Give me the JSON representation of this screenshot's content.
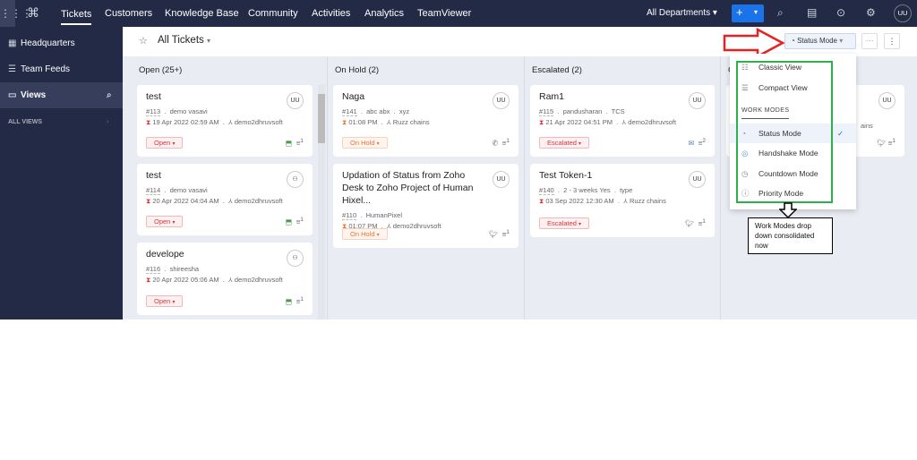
{
  "topbar": {
    "nav": [
      "Tickets",
      "Customers",
      "Knowledge Base",
      "Community",
      "Activities",
      "Analytics",
      "TeamViewer"
    ],
    "department": "All Departments",
    "user_initials": "UU",
    "icons": [
      "apps-grid-icon",
      "logo-icon",
      "plus-icon",
      "search-icon",
      "notifications-icon",
      "gamepad-icon",
      "gear-icon"
    ]
  },
  "sidebar": {
    "items": [
      {
        "label": "Headquarters",
        "icon": "grid-icon"
      },
      {
        "label": "Team Feeds",
        "icon": "feed-icon"
      },
      {
        "label": "Views",
        "icon": "folder-icon"
      }
    ],
    "all_views": "ALL VIEWS"
  },
  "header": {
    "view_title": "All Tickets",
    "mode_button": "Status Mode"
  },
  "columns": [
    {
      "title": "Open (25+)",
      "cards": [
        {
          "title": "test",
          "id": "#113",
          "contact": "demo vasavi",
          "extra": "",
          "time": "19 Apr 2022 02:59 AM",
          "account": "demo2dhruvsoft",
          "status": "Open",
          "avatar": "UU",
          "count": "1"
        },
        {
          "title": "test",
          "id": "#114",
          "contact": "demo vasavi",
          "extra": "",
          "time": "20 Apr 2022 04:04 AM",
          "account": "demo2dhruvsoft",
          "status": "Open",
          "avatar": "",
          "count": "1"
        },
        {
          "title": "develope",
          "id": "#116",
          "contact": "shireesha",
          "extra": "",
          "time": "20 Apr 2022 05:06 AM",
          "account": "demo2dhruvsoft",
          "status": "Open",
          "avatar": "",
          "count": "1"
        }
      ]
    },
    {
      "title": "On Hold (2)",
      "cards": [
        {
          "title": "Naga",
          "id": "#141",
          "contact": "abc abx",
          "extra": "xyz",
          "time": "01:08 PM",
          "account": "Ruzz chains",
          "status": "On Hold",
          "avatar": "UU",
          "count": "1"
        },
        {
          "title": "Updation of Status from Zoho Desk to Zoho Project of Human Hixel...",
          "id": "#110",
          "contact": "HumanPixel",
          "extra": "",
          "time": "01:07 PM",
          "account": "demo2dhruvsoft",
          "status": "On Hold",
          "avatar": "UU",
          "count": "1"
        }
      ]
    },
    {
      "title": "Escalated (2)",
      "cards": [
        {
          "title": "Ram1",
          "id": "#115",
          "contact": "pandusharan",
          "extra": "TCS",
          "time": "21 Apr 2022 04:51 PM",
          "account": "demo2dhruvsoft",
          "status": "Escalated",
          "avatar": "UU",
          "count": "2"
        },
        {
          "title": "Test Token-1",
          "id": "#140",
          "contact": "2 - 3 weeks Yes",
          "extra": "type",
          "time": "03 Sep 2022 12:30 AM",
          "account": "Ruzz chains",
          "status": "Escalated",
          "avatar": "UU",
          "count": "1"
        }
      ]
    },
    {
      "title": "C",
      "cards": [
        {
          "fragment": "ains",
          "avatar": "UU",
          "count": "1"
        }
      ]
    }
  ],
  "dropdown": {
    "views": [
      "Classic View",
      "Compact View"
    ],
    "section": "WORK MODES",
    "modes": [
      "Status Mode",
      "Handshake Mode",
      "Countdown Mode",
      "Priority Mode"
    ],
    "selected": "Status Mode"
  },
  "annotation": "Work Modes drop down consolidated now",
  "colors": {
    "topbar": "#232a45",
    "open": "#d9363e",
    "on_hold": "#e6763a",
    "primary": "#1a73e8",
    "annotation_arrow": "#e52222",
    "highlight_box": "#2bb34a"
  }
}
